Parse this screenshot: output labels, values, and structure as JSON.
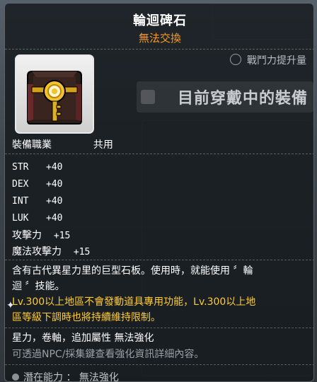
{
  "item": {
    "name": "輪迴碑石",
    "trade_status": "無法交換",
    "icon": "reincarnation-stone-icon"
  },
  "background": {
    "combat_power_label": "戰鬥力提升量",
    "equipped_label": "目前穿戴中的裝備"
  },
  "job": {
    "label": "裝備職業",
    "value": "共用"
  },
  "stats": [
    {
      "name": "STR",
      "value": "+40"
    },
    {
      "name": "DEX",
      "value": "+40"
    },
    {
      "name": "INT",
      "value": "+40"
    },
    {
      "name": "LUK",
      "value": "+40"
    }
  ],
  "attack": {
    "name": "攻擊力",
    "value": "+15"
  },
  "magic_attack": {
    "name": "魔法攻擊力",
    "value": "+15"
  },
  "description": {
    "line1": "含有古代異星力里的巨型石板。使用時，就能使用 〞輪",
    "line2": "迴 〞技能。"
  },
  "warning": {
    "line1": "Lv.300以上地區不會發動道具專用功能，Lv.300以上地",
    "line2": "區等級下調時也將持續維持限制。"
  },
  "enhancement": "星力，卷軸，追加屬性 無法強化",
  "npc_hint": "可透過NPC/採集鍵查看強化資訊詳細內容。",
  "potential": "潛在能力 ： 無法強化",
  "colors": {
    "title": "#ffffff",
    "trade_status": "#ff9a1e",
    "warning": "#ffcc33",
    "hint": "#9aa0a6"
  }
}
